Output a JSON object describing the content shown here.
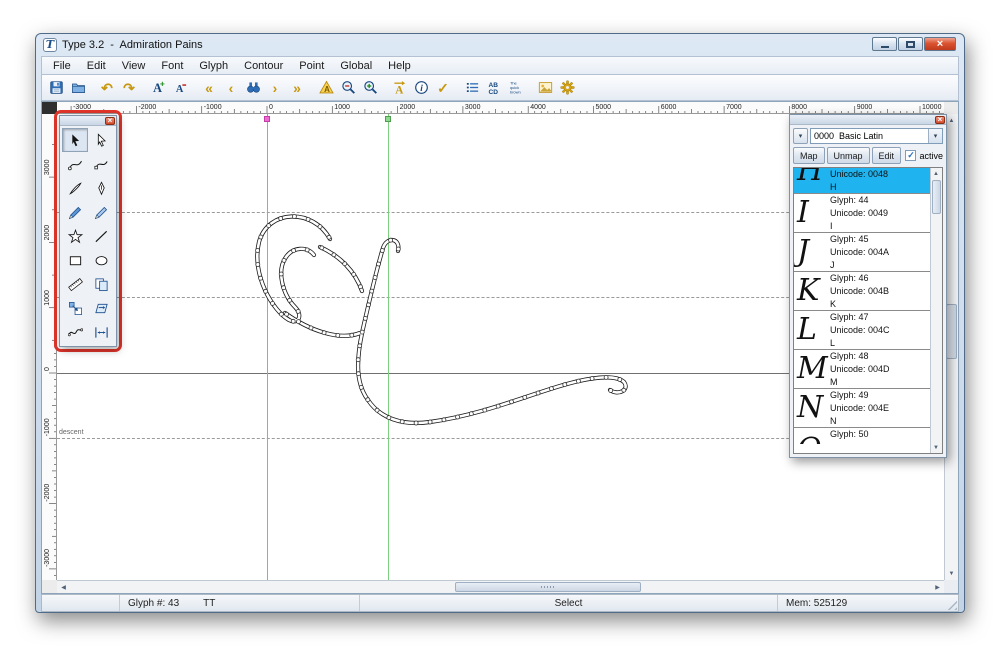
{
  "titlebar": {
    "title": "Type 3.2  -  Admiration Pains",
    "icon_glyph": "T"
  },
  "window_buttons": {
    "close_glyph": "×"
  },
  "icons": {
    "dropdown": "▾",
    "check": "✓",
    "arrow_up": "▲",
    "arrow_down": "▼",
    "arrow_left": "◀",
    "arrow_right": "▶"
  },
  "menubar": {
    "items": [
      "File",
      "Edit",
      "View",
      "Font",
      "Glyph",
      "Contour",
      "Point",
      "Global",
      "Help"
    ]
  },
  "toolbar": {
    "items": [
      {
        "type": "button",
        "name": "save",
        "icon": "floppy"
      },
      {
        "type": "button",
        "name": "open",
        "icon": "folder"
      },
      {
        "type": "sep"
      },
      {
        "type": "button",
        "name": "undo",
        "glyph": "↶"
      },
      {
        "type": "button",
        "name": "redo",
        "glyph": "↷"
      },
      {
        "type": "sep"
      },
      {
        "type": "button",
        "name": "increase-preview",
        "icon": "a-plus"
      },
      {
        "type": "button",
        "name": "decrease-preview",
        "icon": "a-minus"
      },
      {
        "type": "sep"
      },
      {
        "type": "button",
        "name": "first-glyph",
        "glyph": "«"
      },
      {
        "type": "button",
        "name": "previous-glyph",
        "glyph": "‹"
      },
      {
        "type": "button",
        "name": "find-glyph",
        "icon": "binoculars"
      },
      {
        "type": "button",
        "name": "next-glyph",
        "glyph": "›"
      },
      {
        "type": "button",
        "name": "last-glyph",
        "glyph": "»"
      },
      {
        "type": "sep"
      },
      {
        "type": "button",
        "name": "preview-glyph",
        "icon": "triangle-a"
      },
      {
        "type": "button",
        "name": "zoom-out",
        "icon": "zoom-out"
      },
      {
        "type": "button",
        "name": "zoom-in",
        "icon": "zoom-in"
      },
      {
        "type": "sep"
      },
      {
        "type": "button",
        "name": "metrics",
        "icon": "arrow-a"
      },
      {
        "type": "button",
        "name": "info",
        "icon": "info"
      },
      {
        "type": "button",
        "name": "validate",
        "glyph": "✓"
      },
      {
        "type": "sep"
      },
      {
        "type": "button",
        "name": "glyph-list",
        "icon": "list"
      },
      {
        "type": "button",
        "name": "kerning-pairs",
        "icon": "abcd"
      },
      {
        "type": "button",
        "name": "preview-text",
        "icon": "quick-brown"
      },
      {
        "type": "sep"
      },
      {
        "type": "button",
        "name": "background-image",
        "icon": "image"
      },
      {
        "type": "button",
        "name": "settings",
        "icon": "gear"
      }
    ]
  },
  "rulers": {
    "horizontal_labels": [
      "-3000",
      "-2000",
      "-1000",
      "0",
      "1000",
      "2000",
      "3000",
      "4000",
      "5000",
      "6000",
      "7000",
      "8000",
      "9000",
      "10000"
    ],
    "vertical_labels": [
      "3000",
      "2000",
      "1000",
      "0",
      "-1000",
      "-2000",
      "-3000"
    ]
  },
  "canvas": {
    "descent_label": "descent"
  },
  "palette": {
    "tools": [
      {
        "name": "select-tool",
        "icon": "cursor",
        "selected": true
      },
      {
        "name": "node-select-tool",
        "icon": "cursor-outline"
      },
      {
        "name": "curve-point-tool",
        "icon": "curve1"
      },
      {
        "name": "tangent-point-tool",
        "icon": "curve2"
      },
      {
        "name": "knife-tool",
        "icon": "knife"
      },
      {
        "name": "pen-tool",
        "icon": "pen"
      },
      {
        "name": "pencil-tool",
        "icon": "pencil"
      },
      {
        "name": "calligraphy-tool",
        "icon": "pencil2"
      },
      {
        "name": "star-tool",
        "icon": "star"
      },
      {
        "name": "line-tool",
        "icon": "line"
      },
      {
        "name": "rectangle-tool",
        "icon": "rect"
      },
      {
        "name": "ellipse-tool",
        "icon": "ellipse"
      },
      {
        "name": "measure-tool",
        "icon": "ruler"
      },
      {
        "name": "duplicate-tool",
        "icon": "copy"
      },
      {
        "name": "scale-tool",
        "icon": "scale"
      },
      {
        "name": "skew-tool",
        "icon": "skew"
      },
      {
        "name": "freehand-curve-tool",
        "icon": "wave"
      },
      {
        "name": "metrics-tool",
        "icon": "width"
      }
    ]
  },
  "glyph_panel": {
    "range_value": "0000  Basic Latin",
    "map_button": "Map",
    "unmap_button": "Unmap",
    "edit_button": "Edit",
    "active_label": "active",
    "items": [
      {
        "glyph_no": "",
        "unicode": "Unicode: 0048",
        "letter": "H",
        "preview": "H",
        "selected": true,
        "partial": "top"
      },
      {
        "glyph_no": "Glyph: 44",
        "unicode": "Unicode: 0049",
        "letter": "I",
        "preview": "I"
      },
      {
        "glyph_no": "Glyph: 45",
        "unicode": "Unicode: 004A",
        "letter": "J",
        "preview": "J"
      },
      {
        "glyph_no": "Glyph: 46",
        "unicode": "Unicode: 004B",
        "letter": "K",
        "preview": "K"
      },
      {
        "glyph_no": "Glyph: 47",
        "unicode": "Unicode: 004C",
        "letter": "L",
        "preview": "L"
      },
      {
        "glyph_no": "Glyph: 48",
        "unicode": "Unicode: 004D",
        "letter": "M",
        "preview": "M"
      },
      {
        "glyph_no": "Glyph: 49",
        "unicode": "Unicode: 004E",
        "letter": "N",
        "preview": "N"
      },
      {
        "glyph_no": "Glyph: 50",
        "unicode": "",
        "letter": "",
        "preview": "O",
        "partial": "bottom"
      }
    ]
  },
  "statusbar": {
    "glyph_info": "Glyph #: 43",
    "format": "TT",
    "mode": "Select",
    "memory": "Mem: 525129"
  },
  "colors": {
    "selection": "#1fb4ef",
    "accent_gold": "#c79810",
    "accent_blue": "#1f5fa8",
    "guide_magenta": "#f073d8",
    "guide_green": "#7ccf7c",
    "annotation_red": "#e0352b"
  }
}
